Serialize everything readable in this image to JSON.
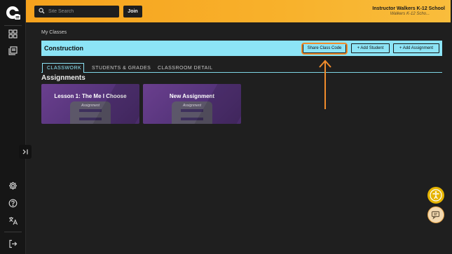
{
  "topbar": {
    "search_placeholder": "Site Search",
    "join_label": "Join",
    "user_name": "Instructor Walkers K-12 School",
    "user_school": "Walkers K-12 Scho..."
  },
  "breadcrumb": "My Classes",
  "class_bar": {
    "title": "Construction",
    "share_label": "Share Class Code",
    "add_student_label": "+ Add Student",
    "add_assignment_label": "+ Add Assignment"
  },
  "tabs": [
    {
      "label": "CLASSWORK",
      "active": true
    },
    {
      "label": "STUDENTS & GRADES",
      "active": false
    },
    {
      "label": "CLASSROOM DETAIL",
      "active": false
    }
  ],
  "assignments": {
    "heading": "Assignments",
    "cards": [
      {
        "title": "Lesson 1: The Me I Choose",
        "tag": "Assignment"
      },
      {
        "title": "New Assignment",
        "tag": "Assignment"
      }
    ]
  },
  "sidebar": {
    "icons": [
      "dashboard-icon",
      "library-icon",
      "settings-icon",
      "help-icon",
      "translate-icon",
      "logout-icon"
    ]
  },
  "colors": {
    "accent_orange": "#f6a21d",
    "class_bar": "#8ce4f6",
    "card_purple": "#6a3f8e",
    "annotation_arrow": "#f08c2c"
  }
}
